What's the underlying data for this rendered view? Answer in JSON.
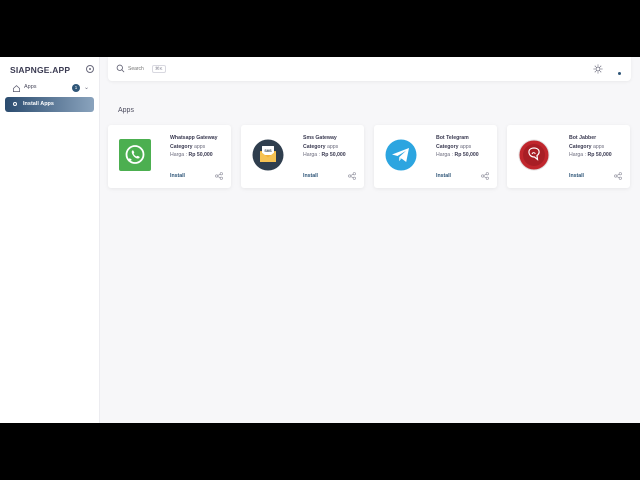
{
  "sidebar": {
    "brand": "SIAPNGE.APP",
    "menu": {
      "apps_label": "Apps",
      "apps_badge": "1",
      "install_label": "Install Apps"
    }
  },
  "topbar": {
    "search_placeholder": "Search",
    "shortcut": "⌘K"
  },
  "main": {
    "section_title": "Apps",
    "cards": [
      {
        "name": "Whatsapp Gateway",
        "category_label": "Category",
        "category": "apps",
        "price_label": "Harga :",
        "price": "Rp 50,000",
        "action": "Install",
        "icon": "whatsapp-icon"
      },
      {
        "name": "Sms Gateway",
        "category_label": "Category",
        "category": "apps",
        "price_label": "Harga :",
        "price": "Rp 50,000",
        "action": "Install",
        "icon": "sms-mail-icon",
        "icon_text": "SMS"
      },
      {
        "name": "Bot Telegram",
        "category_label": "Category",
        "category": "apps",
        "price_label": "Harga :",
        "price": "Rp 50,000",
        "action": "Install",
        "icon": "telegram-icon"
      },
      {
        "name": "Bot Jabber",
        "category_label": "Category",
        "category": "apps",
        "price_label": "Harga :",
        "price": "Rp 50,000",
        "action": "Install",
        "icon": "jabber-icon"
      }
    ]
  },
  "colors": {
    "accent": "#2f5678",
    "whatsapp": "#4caf50",
    "telegram": "#2ca5e0",
    "jabber": "#c0262d",
    "sms_bg": "#2f3e4e",
    "sms_envelope": "#f2b23a"
  }
}
